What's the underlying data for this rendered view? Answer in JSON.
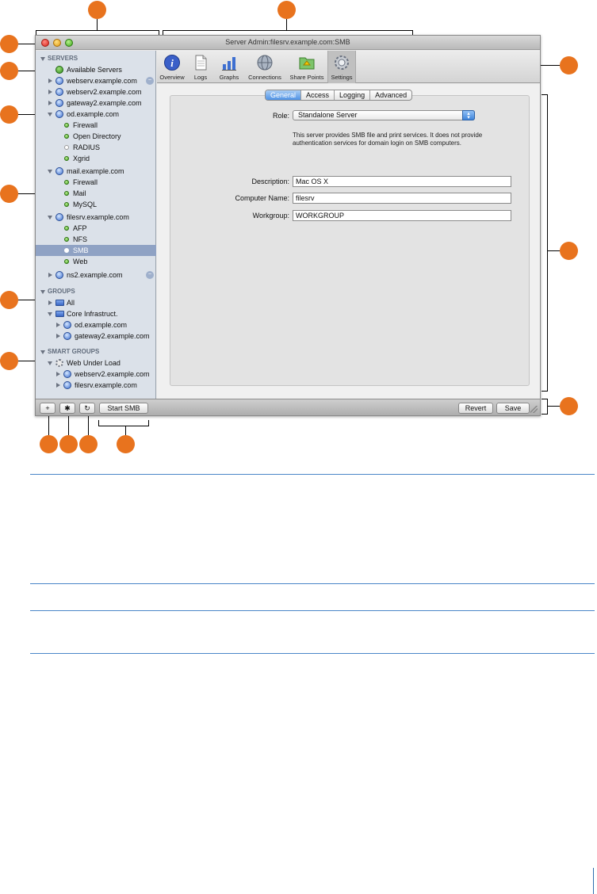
{
  "window": {
    "title": "Server Admin:filesrv.example.com:SMB"
  },
  "sidebar": {
    "servers_header": "SERVERS",
    "available_servers": "Available Servers",
    "servers": [
      {
        "name": "webserv.example.com",
        "expanded": false,
        "activity": true
      },
      {
        "name": "webserv2.example.com",
        "expanded": false,
        "activity": false
      },
      {
        "name": "gateway2.example.com",
        "expanded": false,
        "activity": false
      },
      {
        "name": "od.example.com",
        "expanded": true,
        "services": [
          "Firewall",
          "Open Directory",
          "RADIUS",
          "Xgrid"
        ]
      },
      {
        "name": "mail.example.com",
        "expanded": true,
        "services": [
          "Firewall",
          "Mail",
          "MySQL"
        ]
      },
      {
        "name": "filesrv.example.com",
        "expanded": true,
        "services": [
          "AFP",
          "NFS",
          "SMB",
          "Web"
        ]
      },
      {
        "name": "ns2.example.com",
        "expanded": false,
        "activity": true
      }
    ],
    "groups_header": "GROUPS",
    "groups": [
      {
        "name": "All",
        "expanded": false
      },
      {
        "name": "Core Infrastruct.",
        "expanded": true,
        "members": [
          "od.example.com",
          "gateway2.example.com"
        ]
      }
    ],
    "smart_groups_header": "SMART GROUPS",
    "smart_groups": [
      {
        "name": "Web Under Load",
        "expanded": true,
        "members": [
          "webserv2.example.com",
          "filesrv.example.com"
        ]
      }
    ],
    "selected": "SMB"
  },
  "toolbar": {
    "buttons": [
      {
        "label": "Overview",
        "icon": "info-icon"
      },
      {
        "label": "Logs",
        "icon": "document-icon"
      },
      {
        "label": "Graphs",
        "icon": "bar-graph-icon"
      },
      {
        "label": "Connections",
        "icon": "globe-icon"
      },
      {
        "label": "Share Points",
        "icon": "shared-folder-icon"
      },
      {
        "label": "Settings",
        "icon": "gear-icon"
      }
    ],
    "active": "Settings"
  },
  "tabs": {
    "items": [
      "General",
      "Access",
      "Logging",
      "Advanced"
    ],
    "selected": "General"
  },
  "general": {
    "role_label": "Role:",
    "role_value": "Standalone Server",
    "role_description": "This server provides SMB file and print services. It does not provide authentication services for domain login on SMB computers.",
    "description_label": "Description:",
    "description_value": "Mac OS X",
    "computer_name_label": "Computer Name:",
    "computer_name_value": "filesrv",
    "workgroup_label": "Workgroup:",
    "workgroup_value": "WORKGROUP"
  },
  "bottombar": {
    "add_glyph": "+",
    "action_glyph": "✱",
    "refresh_glyph": "↻",
    "start_label": "Start SMB",
    "revert_label": "Revert",
    "save_label": "Save"
  },
  "colors": {
    "callout": "#e8731e",
    "rule": "#4a86c8",
    "selection": "#8fa2c4",
    "tab_selected": "#4f93e6"
  }
}
